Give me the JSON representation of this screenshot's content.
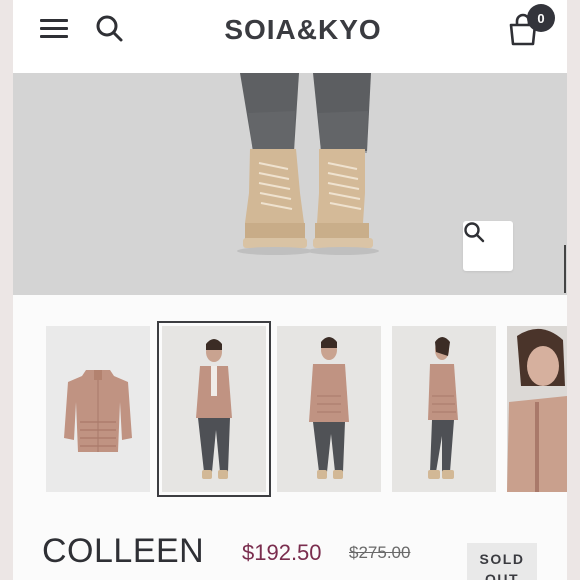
{
  "header": {
    "brand": "SOIA&KYO",
    "cart_count": "0"
  },
  "icons": {
    "menu": "hamburger-icon",
    "search": "search-icon",
    "cart": "shopping-bag-icon",
    "zoom": "zoom-icon"
  },
  "gallery": {
    "thumbnails": [
      {
        "alt": "jacket-flat-lay"
      },
      {
        "alt": "model-front-full"
      },
      {
        "alt": "model-front-full-2"
      },
      {
        "alt": "model-side-full"
      },
      {
        "alt": "model-closeup"
      }
    ],
    "active_index": 1
  },
  "product": {
    "name": "COLLEEN",
    "sale_price": "$192.50",
    "original_price": "$275.00",
    "badge": "SOLD OUT"
  },
  "colors": {
    "text_dark": "#2f3035",
    "sale_price": "#7a2d4e",
    "jacket": "#c09382",
    "page_bg": "#fbfbfb"
  }
}
